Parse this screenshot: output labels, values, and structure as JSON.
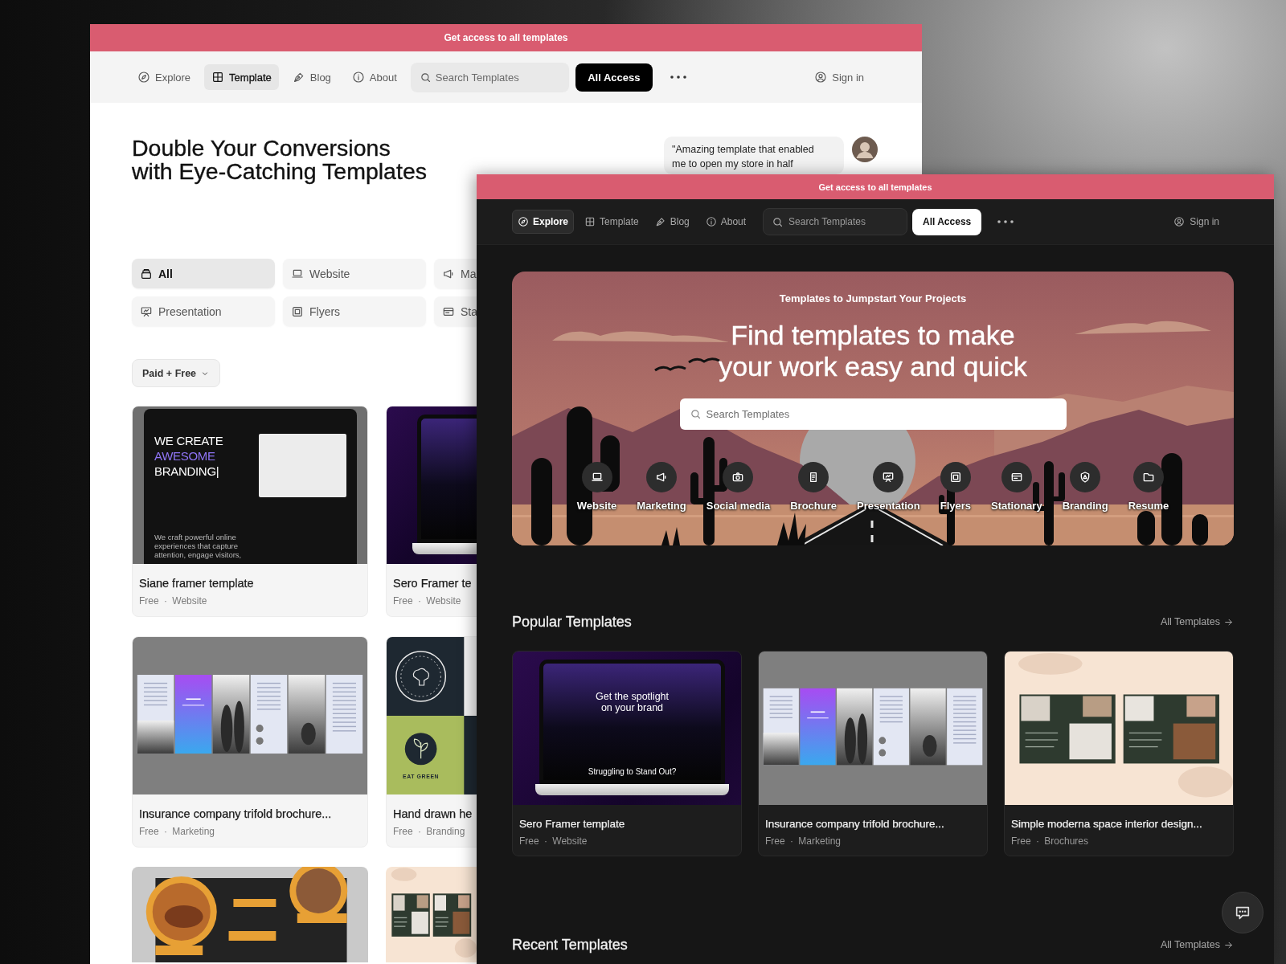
{
  "back_window": {
    "promo_bar": {
      "text": "Get access to all templates"
    },
    "nav": {
      "items": [
        {
          "label": "Explore",
          "selected": false
        },
        {
          "label": "Template",
          "selected": true
        },
        {
          "label": "Blog",
          "selected": false
        },
        {
          "label": "About",
          "selected": false
        }
      ],
      "search": {
        "placeholder": "Search Templates"
      },
      "cta": "All Access",
      "sign_in": "Sign in"
    },
    "hero": {
      "title_lines": [
        "Double Your Conversions",
        "with Eye-Catching Templates"
      ],
      "quote_lines": [
        "\"Amazing template that enabled",
        "me to open my store in half"
      ]
    },
    "filters": [
      {
        "label": "All",
        "selected": true
      },
      {
        "label": "Website",
        "selected": false
      },
      {
        "label": "Ma",
        "selected": false
      },
      {
        "label": "Presentation",
        "selected": false
      },
      {
        "label": "Flyers",
        "selected": false
      },
      {
        "label": "Sta",
        "selected": false
      }
    ],
    "price_filter": "Paid + Free",
    "cards": [
      {
        "thumb": {
          "kind": "website",
          "lines": [
            "WE CREATE",
            "AWESOME",
            "BRANDING|"
          ],
          "body": "We craft powerful online experiences that capture attention, engage visitors,"
        },
        "title": "Siane framer template",
        "meta": "Free · Website"
      },
      {
        "thumb": {
          "kind": "laptop"
        },
        "title": "Sero Framer te",
        "meta": "Free · Website"
      },
      {
        "thumb": {
          "kind": "brochure"
        },
        "title": "Insurance company trifold brochure...",
        "meta": "Free · Marketing"
      },
      {
        "thumb": {
          "kind": "branding",
          "body": "EAT GREEN"
        },
        "title": "Hand drawn he",
        "meta": "Free · Branding"
      },
      {
        "thumb": {
          "kind": "menu"
        }
      },
      {
        "thumb": {
          "kind": "interior"
        }
      }
    ]
  },
  "front_window": {
    "promo_bar": {
      "text": "Get access to all templates"
    },
    "nav": {
      "items": [
        {
          "label": "Explore",
          "selected": true
        },
        {
          "label": "Template",
          "selected": false
        },
        {
          "label": "Blog",
          "selected": false
        },
        {
          "label": "About",
          "selected": false
        }
      ],
      "search": {
        "placeholder": "Search Templates"
      },
      "cta": "All Access",
      "sign_in": "Sign in"
    },
    "hero": {
      "eyebrow": "Templates to Jumpstart Your Projects",
      "title_lines": [
        "Find templates to make",
        "your work easy and quick"
      ],
      "search": {
        "placeholder": "Search Templates"
      },
      "categories": [
        "Website",
        "Marketing",
        "Social media",
        "Brochure",
        "Presentation",
        "Flyers",
        "Stationary",
        "Branding",
        "Resume"
      ]
    },
    "sections": [
      {
        "title": "Popular Templates",
        "link": "All Templates",
        "cards": [
          {
            "thumb": {
              "kind": "laptop",
              "lines": [
                "Get the spotlight",
                "on your brand"
              ],
              "body": "Struggling to Stand Out?"
            },
            "title": "Sero Framer template",
            "meta": "Free · Website"
          },
          {
            "thumb": {
              "kind": "brochure"
            },
            "title": "Insurance company trifold brochure...",
            "meta": "Free · Marketing"
          },
          {
            "thumb": {
              "kind": "interior"
            },
            "title": "Simple moderna space interior design...",
            "meta": "Free · Brochures"
          }
        ]
      },
      {
        "title": "Recent Templates",
        "link": "All Templates"
      }
    ]
  }
}
